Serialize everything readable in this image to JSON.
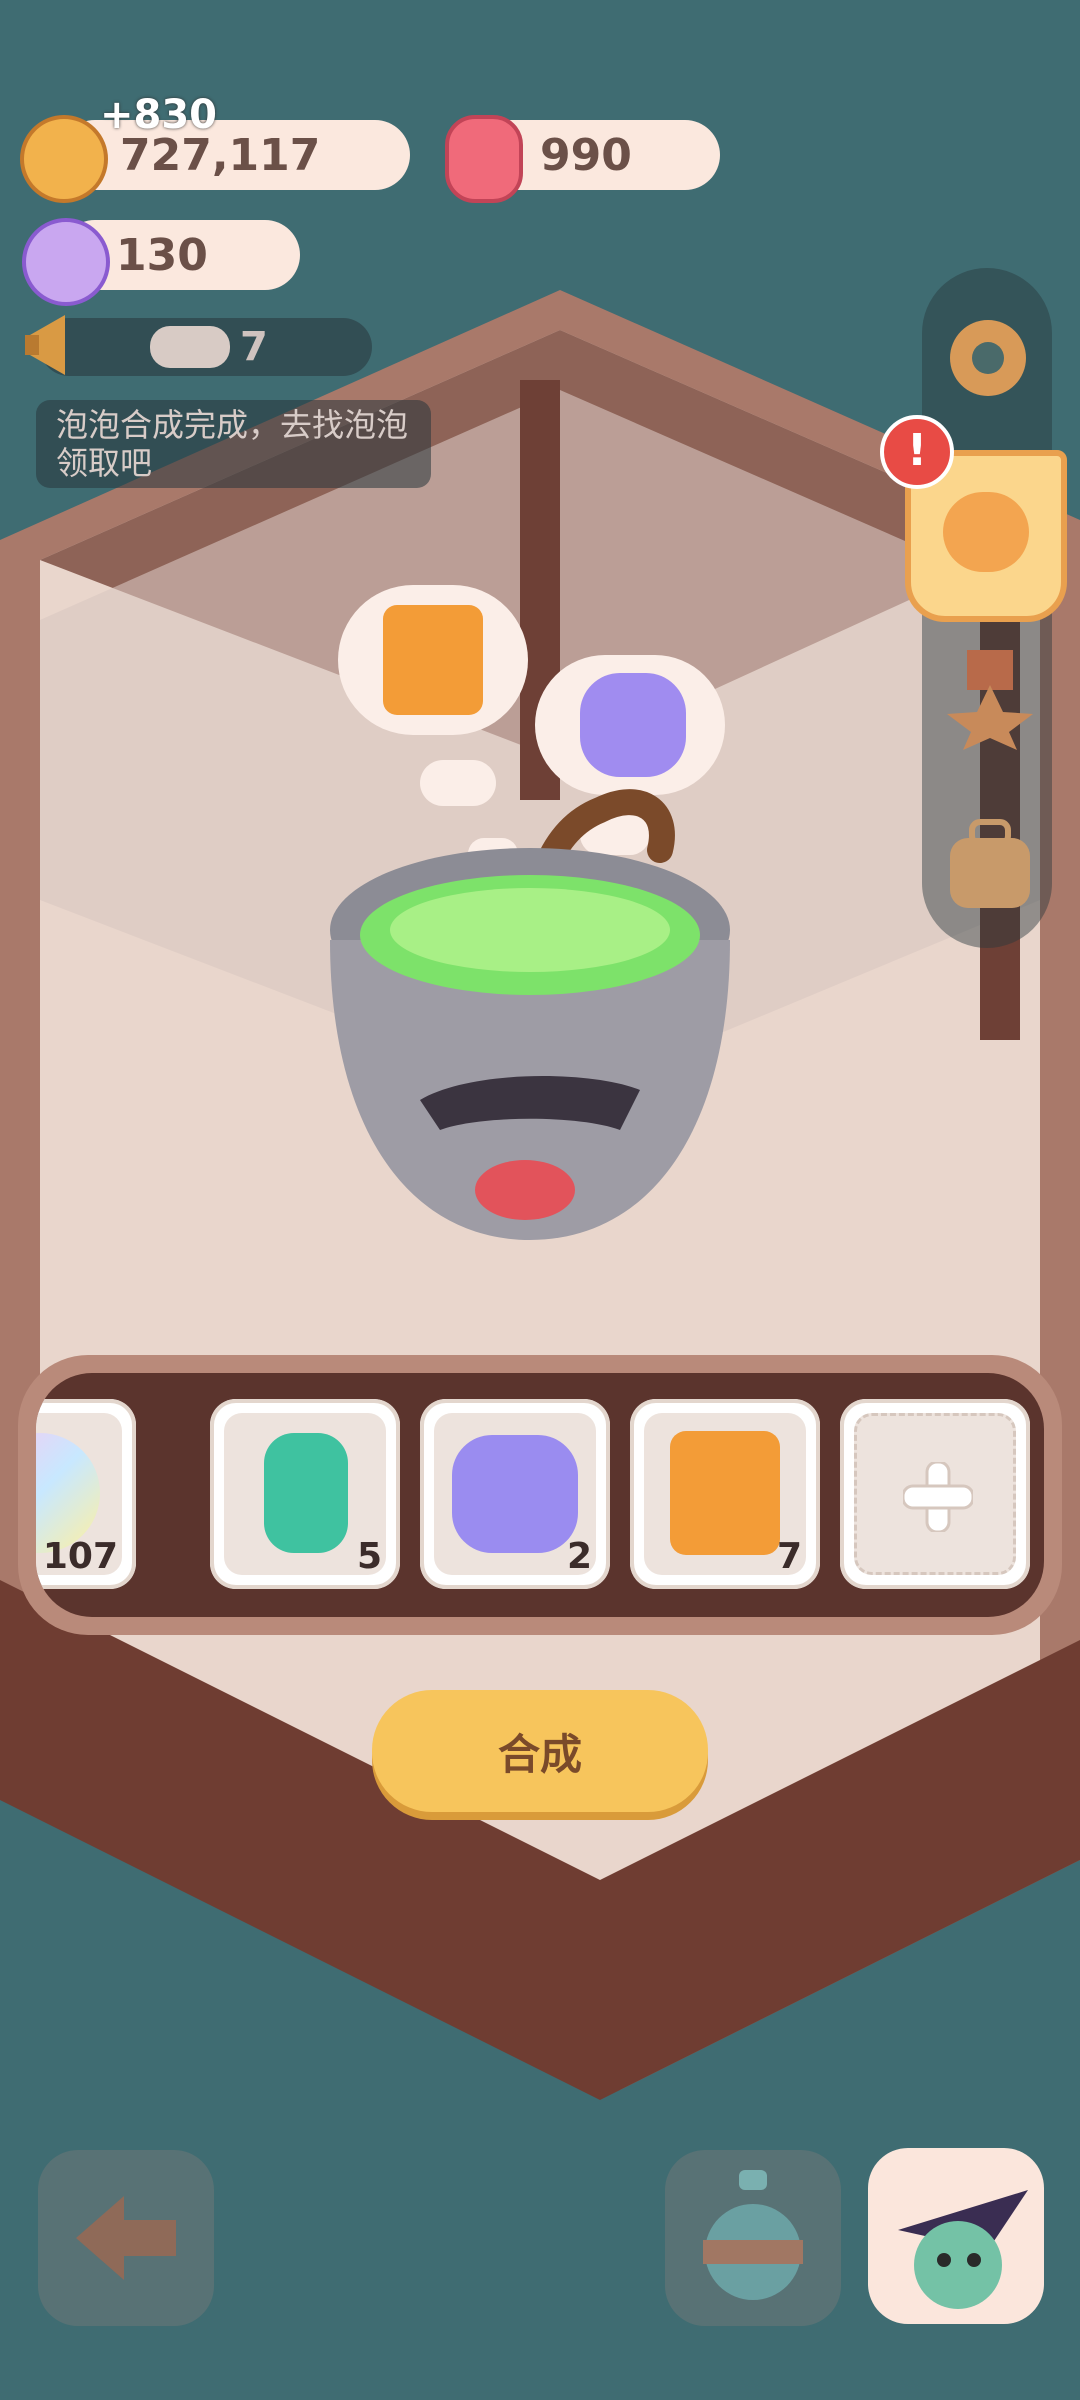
{
  "resources": {
    "cookie": {
      "value": "727,117",
      "gain": "+830",
      "icon": "cookie-icon"
    },
    "gem": {
      "value": "990",
      "icon": "pink-creature-icon"
    },
    "candy": {
      "value": "130",
      "icon": "candy-icon"
    }
  },
  "notice": {
    "count": "7",
    "message": "泡泡合成完成，去找泡泡领取吧"
  },
  "inventory": {
    "slots": [
      {
        "name": "rainbow-shell",
        "count": "107"
      },
      {
        "name": "potion-bottle",
        "count": "5"
      },
      {
        "name": "star-sack",
        "count": "2"
      },
      {
        "name": "orange-bag",
        "count": "7"
      },
      {
        "name": "empty-add",
        "count": ""
      }
    ]
  },
  "action": {
    "synthesize_label": "合成"
  },
  "colors": {
    "background": "#3f6c72",
    "button": "#f7c55c",
    "panel": "#7a4a3d",
    "alert": "#e84b45"
  }
}
